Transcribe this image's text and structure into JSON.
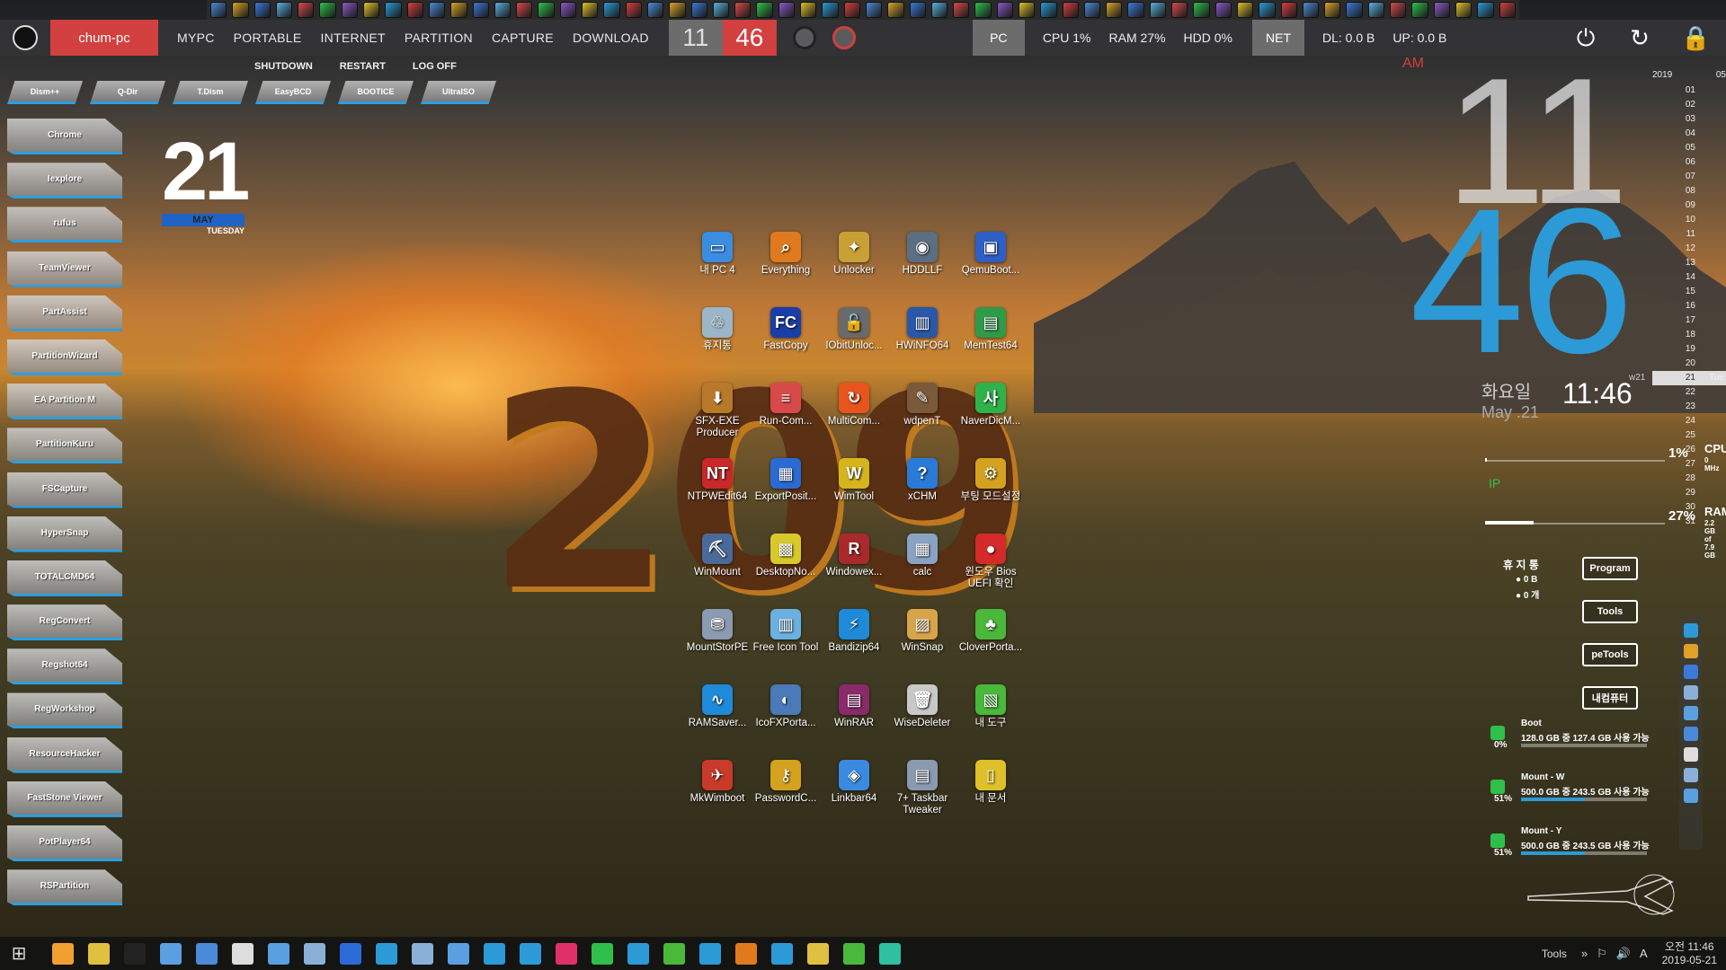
{
  "taskbar_top": {
    "computer_name": "chum-pc",
    "nav": [
      "MYPC",
      "PORTABLE",
      "INTERNET",
      "PARTITION",
      "CAPTURE",
      "DOWNLOAD"
    ],
    "clock_hour": "11",
    "clock_minute": "46",
    "pc_label": "PC",
    "cpu": "CPU  1%",
    "ram": "RAM  27%",
    "hdd": "HDD  0%",
    "net_label": "NET",
    "dl": "DL:  0.0 B",
    "up": "UP:  0.0 B"
  },
  "power_row": [
    "SHUTDOWN",
    "RESTART",
    "LOG OFF"
  ],
  "tool_row": [
    "Dism++",
    "Q-Dir",
    "T.Dism",
    "EasyBCD",
    "BOOTICE",
    "UltraISO"
  ],
  "left_apps": [
    "Chrome",
    "Iexplore",
    "rufus",
    "TeamViewer",
    "PartAssist",
    "PartitionWizard",
    "EA Partition M",
    "PartitionKuru",
    "FSCapture",
    "HyperSnap",
    "TOTALCMD64",
    "RegConvert",
    "Regshot64",
    "RegWorkshop",
    "ResourceHacker",
    "FastStone Viewer",
    "PotPlayer64",
    "RSPartition"
  ],
  "date_widget": {
    "day": "21",
    "month": "MAY",
    "weekday": "TUESDAY"
  },
  "desktop_icons": [
    {
      "label": "내 PC 4",
      "color": "#3a8de0",
      "glyph": "▭"
    },
    {
      "label": "Everything",
      "color": "#e07a1e",
      "glyph": "⌕"
    },
    {
      "label": "Unlocker",
      "color": "#c8a035",
      "glyph": "✦"
    },
    {
      "label": "HDDLLF",
      "color": "#5b6f82",
      "glyph": "◉"
    },
    {
      "label": "QemuBoot...",
      "color": "#2f5fc4",
      "glyph": "▣"
    },
    {
      "label": "휴지통",
      "color": "#9ab6c8",
      "glyph": "♲"
    },
    {
      "label": "FastCopy",
      "color": "#1a3ea8",
      "glyph": "FC"
    },
    {
      "label": "IObitUnloc...",
      "color": "#6a6a6a",
      "glyph": "🔓"
    },
    {
      "label": "HWiNFO64",
      "color": "#2a58a8",
      "glyph": "▥"
    },
    {
      "label": "MemTest64",
      "color": "#2e9a4a",
      "glyph": "▤"
    },
    {
      "label": "SFX-EXE Producer",
      "color": "#b87a2a",
      "glyph": "⬇"
    },
    {
      "label": "Run-Com...",
      "color": "#d84a4a",
      "glyph": "≡"
    },
    {
      "label": "MultiCom...",
      "color": "#e8541e",
      "glyph": "↻"
    },
    {
      "label": "wdpenT",
      "color": "#7a5a3a",
      "glyph": "✎"
    },
    {
      "label": "NaverDicM...",
      "color": "#2fb24a",
      "glyph": "사"
    },
    {
      "label": "NTPWEdit64",
      "color": "#c82828",
      "glyph": "NT"
    },
    {
      "label": "ExportPosit...",
      "color": "#2a6ad4",
      "glyph": "▦"
    },
    {
      "label": "WimTool",
      "color": "#d6b41e",
      "glyph": "W"
    },
    {
      "label": "xCHM",
      "color": "#2a7ad8",
      "glyph": "?"
    },
    {
      "label": "부팅 모드설정",
      "color": "#d4a21e",
      "glyph": "⚙"
    },
    {
      "label": "WinMount",
      "color": "#4a6a9a",
      "glyph": "⛏"
    },
    {
      "label": "DesktopNo...",
      "color": "#d8c82a",
      "glyph": "▩"
    },
    {
      "label": "Windowex...",
      "color": "#a82a2a",
      "glyph": "R"
    },
    {
      "label": "calc",
      "color": "#8aa2c4",
      "glyph": "▦"
    },
    {
      "label": "윈도우 Bios UEFI 확인",
      "color": "#d42a2a",
      "glyph": "●"
    },
    {
      "label": "MountStorPE",
      "color": "#8a9ab0",
      "glyph": "⛃"
    },
    {
      "label": "Free Icon Tool",
      "color": "#6ab0e0",
      "glyph": "▥"
    },
    {
      "label": "Bandizip64",
      "color": "#1e8ad8",
      "glyph": "⚡"
    },
    {
      "label": "WinSnap",
      "color": "#d8a44a",
      "glyph": "▨"
    },
    {
      "label": "CloverPorta...",
      "color": "#4ab83a",
      "glyph": "♣"
    },
    {
      "label": "RAMSaver...",
      "color": "#1e8ad8",
      "glyph": "∿"
    },
    {
      "label": "IcoFXPorta...",
      "color": "#4a7ab8",
      "glyph": "◐"
    },
    {
      "label": "WinRAR",
      "color": "#8a2a6a",
      "glyph": "▤"
    },
    {
      "label": "WiseDeleter",
      "color": "#c8c8c8",
      "glyph": "🗑"
    },
    {
      "label": "내 도구",
      "color": "#4ab83a",
      "glyph": "▧"
    },
    {
      "label": "MkWimboot",
      "color": "#c83a2a",
      "glyph": "✈"
    },
    {
      "label": "PasswordC...",
      "color": "#d4a21e",
      "glyph": "⚷"
    },
    {
      "label": "Linkbar64",
      "color": "#3a8ae0",
      "glyph": "◈"
    },
    {
      "label": "7+ Taskbar Tweaker",
      "color": "#8a9ab0",
      "glyph": "▤"
    },
    {
      "label": "내 문서",
      "color": "#e0c02a",
      "glyph": "▯"
    }
  ],
  "big_clock": {
    "ampm": "AM",
    "hour": "11",
    "minute": "46"
  },
  "calendar": {
    "year": "2019",
    "month": "05",
    "days": [
      "01",
      "02",
      "03",
      "04",
      "05",
      "06",
      "07",
      "08",
      "09",
      "10",
      "11",
      "12",
      "13",
      "14",
      "15",
      "16",
      "17",
      "18",
      "19",
      "20",
      "21",
      "22",
      "23",
      "24",
      "25",
      "26",
      "27",
      "28",
      "29",
      "30",
      "31"
    ],
    "today_index": 20,
    "week_label": "w21",
    "today_weekday": "Tue"
  },
  "date_time_widget": {
    "weekday_kr": "화요일",
    "month_day": "May .21",
    "time": "11:46"
  },
  "cpu_meter": {
    "value": "1%",
    "name": "CPU",
    "sub": "0 MHz",
    "percent": 1
  },
  "ip_label": "IP",
  "ram_meter": {
    "value": "27%",
    "name": "RAM",
    "sub1": "2.2 GB",
    "sub2": "of 7.9 GB",
    "percent": 27
  },
  "recycle_bin": {
    "label": "휴 지 통",
    "size": "0 B",
    "count": "0 개"
  },
  "side_buttons": [
    "Program",
    "Tools",
    "peTools",
    "내컴퓨터"
  ],
  "drives": [
    {
      "name": "Boot",
      "info": "128.0 GB 중 127.4 GB 사용 가능",
      "pct": "0%",
      "fill": 0.004
    },
    {
      "name": "Mount - W",
      "info": "500.0 GB 중 243.5 GB 사용 가능",
      "pct": "51%",
      "fill": 0.51
    },
    {
      "name": "Mount - Y",
      "info": "500.0 GB 중 243.5 GB 사용 가능",
      "pct": "51%",
      "fill": 0.51
    }
  ],
  "taskbar": {
    "tools_label": "Tools",
    "clock_top": "오전 11:46",
    "clock_bottom": "2019-05-21",
    "ime": "A"
  },
  "colors": {
    "accent_red": "#d2403f",
    "accent_blue": "#2c9ad6",
    "accent_green": "#2ec04a"
  }
}
